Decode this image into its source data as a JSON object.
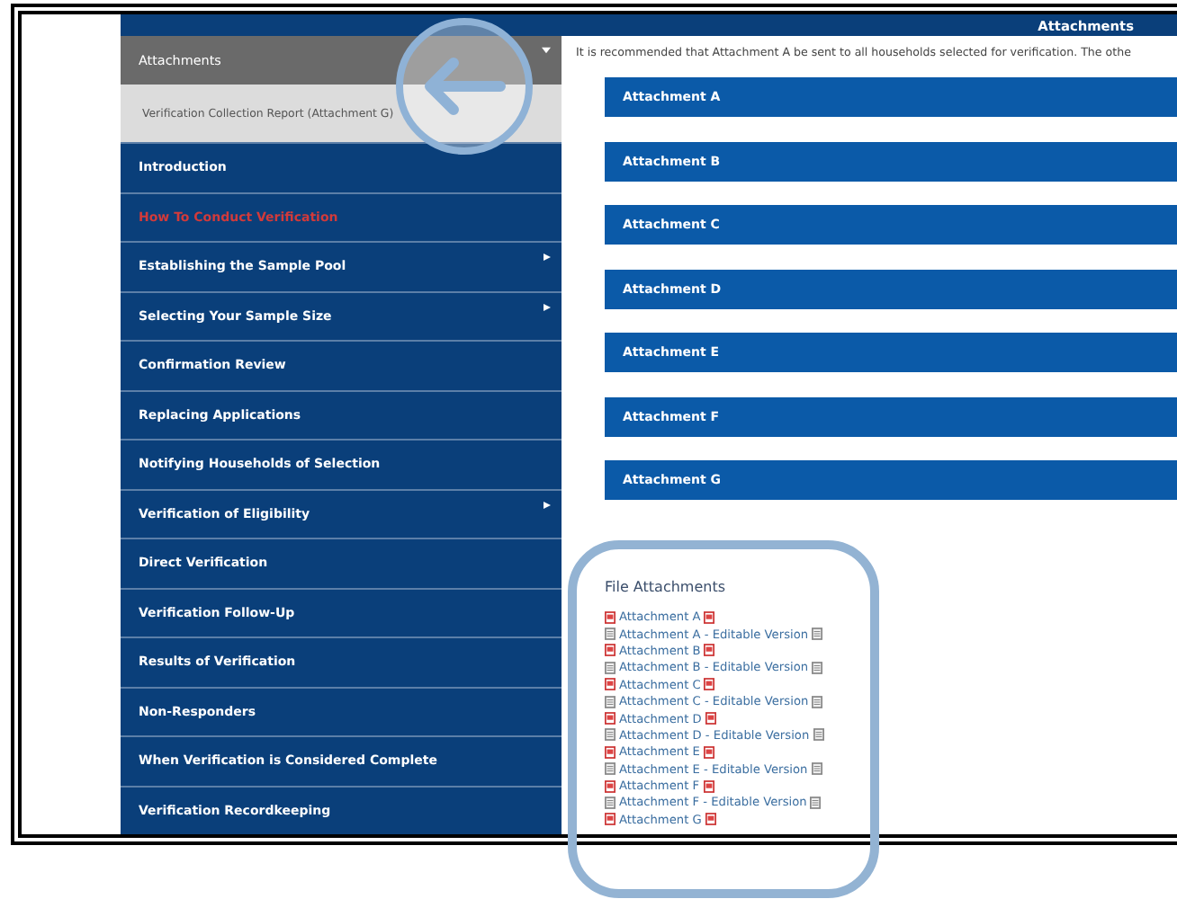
{
  "sidebar": {
    "items": [
      {
        "label": "Attachments",
        "kind": "header",
        "expanded": true
      },
      {
        "label": "Verification Collection Report (Attachment G)",
        "kind": "subitem"
      },
      {
        "label": "Introduction",
        "kind": "item",
        "active": false,
        "has_submenu": false
      },
      {
        "label": "How To Conduct Verification",
        "kind": "item",
        "active": true,
        "has_submenu": false
      },
      {
        "label": "Establishing the Sample Pool",
        "kind": "item",
        "active": false,
        "has_submenu": true
      },
      {
        "label": "Selecting Your Sample Size",
        "kind": "item",
        "active": false,
        "has_submenu": true
      },
      {
        "label": "Confirmation Review",
        "kind": "item",
        "active": false,
        "has_submenu": false
      },
      {
        "label": "Replacing Applications",
        "kind": "item",
        "active": false,
        "has_submenu": false
      },
      {
        "label": "Notifying Households of Selection",
        "kind": "item",
        "active": false,
        "has_submenu": false
      },
      {
        "label": "Verification of Eligibility",
        "kind": "item",
        "active": false,
        "has_submenu": true
      },
      {
        "label": "Direct Verification",
        "kind": "item",
        "active": false,
        "has_submenu": false
      },
      {
        "label": "Verification Follow-Up",
        "kind": "item",
        "active": false,
        "has_submenu": false
      },
      {
        "label": "Results of Verification",
        "kind": "item",
        "active": false,
        "has_submenu": false
      },
      {
        "label": "Non-Responders",
        "kind": "item",
        "active": false,
        "has_submenu": false
      },
      {
        "label": "When Verification is Considered Complete",
        "kind": "item",
        "active": false,
        "has_submenu": false
      },
      {
        "label": "Verification Recordkeeping",
        "kind": "item",
        "active": false,
        "has_submenu": false
      }
    ]
  },
  "main": {
    "title": "Attachments",
    "intro": "It is recommended that Attachment A be sent to all households selected for verification. The othe",
    "sections": [
      "Attachment A",
      "Attachment B",
      "Attachment C",
      "Attachment D",
      "Attachment E",
      "Attachment F",
      "Attachment G"
    ],
    "file_attachments": {
      "heading": "File Attachments",
      "files": [
        {
          "label": "Attachment A",
          "kind": "pdf"
        },
        {
          "label": "Attachment A - Editable Version",
          "kind": "doc"
        },
        {
          "label": "Attachment B",
          "kind": "pdf"
        },
        {
          "label": "Attachment B - Editable Version",
          "kind": "doc"
        },
        {
          "label": "Attachment C",
          "kind": "pdf"
        },
        {
          "label": "Attachment C - Editable Version",
          "kind": "doc"
        },
        {
          "label": "Attachment D",
          "kind": "pdf"
        },
        {
          "label": "Attachment D - Editable Version",
          "kind": "doc"
        },
        {
          "label": "Attachment E",
          "kind": "pdf"
        },
        {
          "label": "Attachment E - Editable Version",
          "kind": "doc"
        },
        {
          "label": "Attachment F",
          "kind": "pdf"
        },
        {
          "label": "Attachment F - Editable Version",
          "kind": "doc"
        },
        {
          "label": "Attachment G",
          "kind": "pdf"
        }
      ]
    }
  }
}
